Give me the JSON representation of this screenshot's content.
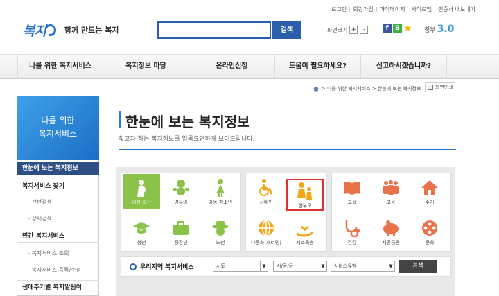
{
  "util_links": [
    "로그인",
    "회원가입",
    "마이페이지",
    "사이트맵",
    "인증서 내보내기"
  ],
  "logo": {
    "mark": "복지",
    "slogan": "함께 만드는 복지"
  },
  "search": {
    "value": "",
    "button": "검색"
  },
  "font_size": {
    "label": "화면크기",
    "plus": "+",
    "minus": "-"
  },
  "social": {
    "facebook": "f",
    "blog": "B"
  },
  "gov": {
    "text": "정부",
    "version": "3.0"
  },
  "gnb": [
    "나를 위한 복지서비스",
    "복지정보 마당",
    "온라인신청",
    "도움이 필요하세요?",
    "신고하시겠습니까?"
  ],
  "breadcrumb": {
    "items": [
      "나를 위한 복지서비스",
      "한눈에 보는 복지정보"
    ],
    "sep": ">",
    "print": "화면인쇄"
  },
  "sidebar": {
    "head_line1": "나를 위한",
    "head_line2": "복지서비스",
    "items": [
      {
        "label": "한눈에 보는 복지정보"
      },
      {
        "label": "복지서비스 찾기"
      },
      {
        "label": "간편검색"
      },
      {
        "label": "상세검색"
      },
      {
        "label": "민간 복지서비스"
      },
      {
        "label": "복지서비스 조회"
      },
      {
        "label": "복지서비스 등록/수정"
      },
      {
        "label": "생애주기별 복지알림이"
      }
    ]
  },
  "page": {
    "title": "한눈에 보는 복지정보",
    "desc": "찾고자 하는 복지정보를 일목요연하게 보여드립니다."
  },
  "categories": {
    "life": [
      "임신·출산",
      "영유아",
      "아동·청소년",
      "청년",
      "중장년",
      "노년"
    ],
    "target": [
      "장애인",
      "한부모",
      "다문화(새터민)",
      "저소득층"
    ],
    "topic": [
      "교육",
      "고용",
      "주거",
      "건강",
      "서민금융",
      "문화"
    ]
  },
  "regional": {
    "label": "우리지역 복지서비스",
    "selects": [
      "시도",
      "시/군/구",
      "서비스유형"
    ],
    "button": "검색"
  },
  "colors": {
    "primary": "#2b5fab",
    "accent_green": "#8bc34a",
    "highlight": "#e03131",
    "icon_orange": "#e8734a",
    "icon_yellow": "#f0a818"
  }
}
